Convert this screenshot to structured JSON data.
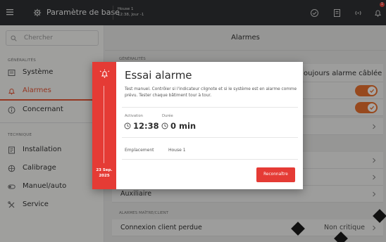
{
  "topbar": {
    "app_title": "Paramètre de base",
    "house_name": "House 1",
    "house_time": "12:38, Jour -1",
    "notification_count": "1"
  },
  "sidebar": {
    "search_placeholder": "Chercher",
    "section_general": "GÉNÉRALITÉS",
    "section_technique": "TECHNIQUE",
    "items": [
      {
        "label": "Système",
        "icon": "system-icon"
      },
      {
        "label": "Alarmes",
        "icon": "alarm-icon",
        "active": true
      },
      {
        "label": "Concernant",
        "icon": "info-icon"
      },
      {
        "label": "Installation",
        "icon": "installation-icon"
      },
      {
        "label": "Calibrage",
        "icon": "calibration-icon"
      },
      {
        "label": "Manuel/auto",
        "icon": "manual-auto-icon"
      },
      {
        "label": "Service",
        "icon": "service-icon"
      }
    ]
  },
  "main": {
    "title": "Alarmes",
    "section_general": "GÉNÉRALITÉS",
    "wired_alarm_label": "oujours alarme câblée",
    "toggles": [
      true,
      true
    ],
    "auxiliary_label": "Auxiliaire",
    "section_master_client": "ALARMES MAÎTRE/CLIENT",
    "connection_lost_label": "Connexion client perdue",
    "connection_lost_value": "Non critique"
  },
  "dialog": {
    "title": "Essai alarme",
    "description": "Test manuel. Contrôler si l'indicateur clignote et si le système est en alarme comme prévu. Tester chaque bâtiment tour à tour.",
    "activation_caption": "Activation",
    "activation_value": "12:38",
    "duration_caption": "Durée",
    "duration_value": "0 min",
    "location_caption": "Emplacement",
    "location_value": "House 1",
    "date_line1": "23 Sep.",
    "date_line2": "2025",
    "acknowledge_label": "Reconnaître"
  },
  "colors": {
    "accent_orange": "#e8702f",
    "alarm_red": "#e53b35",
    "topbar": "#2e3133"
  }
}
